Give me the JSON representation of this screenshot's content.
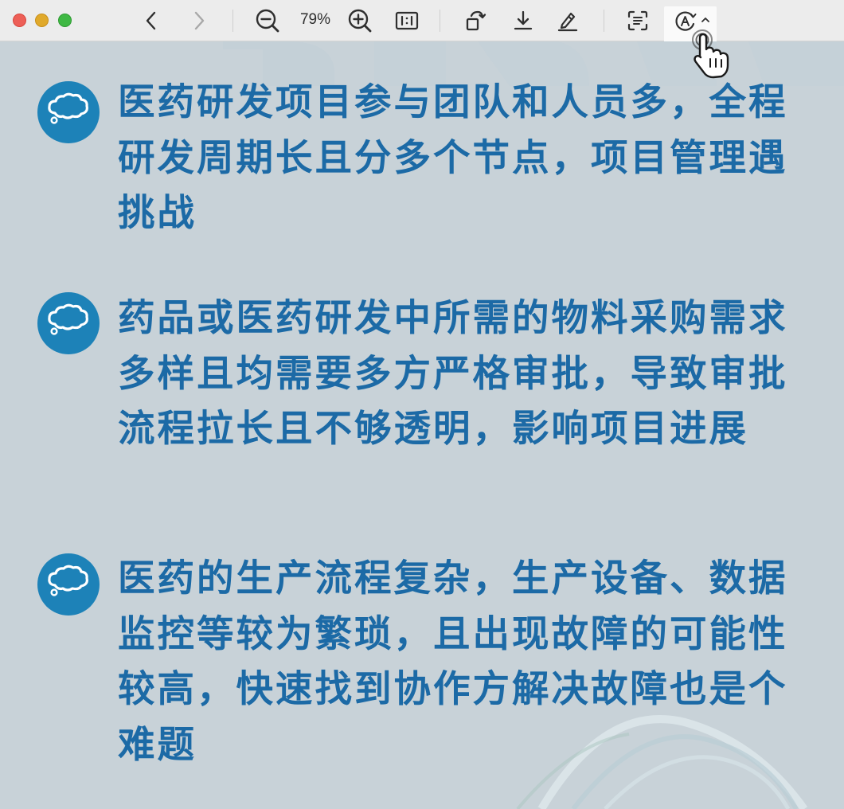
{
  "toolbar": {
    "zoom_level": "79%"
  },
  "bullets": [
    {
      "text": "医药研发项目参与团队和人员多，全程研发周期长且分多个节点，项目管理遇挑战"
    },
    {
      "text": "药品或医药研发中所需的物料采购需求多样且均需要多方严格审批，导致审批流程拉长且不够透明，影响项目进展"
    },
    {
      "text": "医药的生产流程复杂，生产设备、数据监控等较为繁琐，且出现故障的可能性较高，快速找到协作方解决故障也是个难题"
    }
  ],
  "colors": {
    "page_background": "#c8d2d8",
    "bullet_text": "#1c6aa6",
    "bubble_fill": "#1d82b8",
    "toolbar_background": "#ececec"
  },
  "icons": [
    "back-chevron-icon",
    "forward-chevron-icon",
    "zoom-out-icon",
    "zoom-in-icon",
    "actual-size-icon",
    "rotate-icon",
    "download-icon",
    "highlight-pen-icon",
    "text-recognition-icon",
    "markup-circle-a-icon",
    "chevron-up-icon",
    "thought-bubble-icon",
    "pointing-hand-cursor-icon"
  ]
}
